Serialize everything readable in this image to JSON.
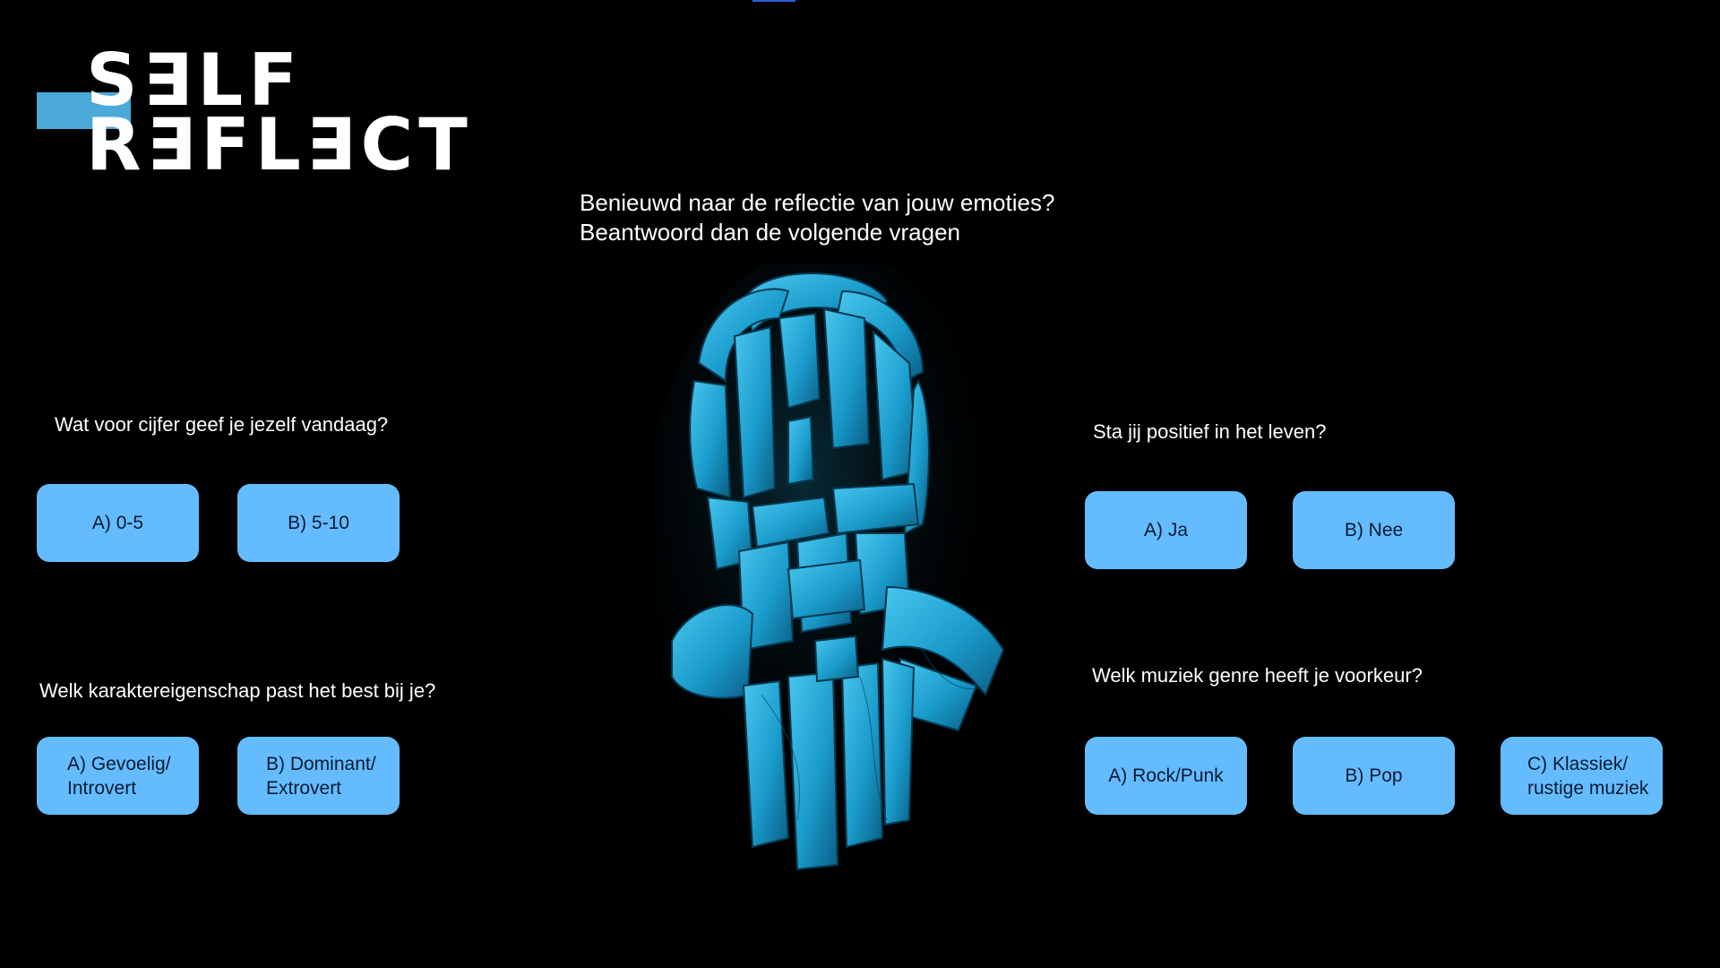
{
  "logo": {
    "line1": "S∃LF",
    "line2": "R∃FL∃CT"
  },
  "intro": {
    "line1": "Benieuwd naar de reflectie van jouw emoties?",
    "line2": "Beantwoord dan de volgende vragen"
  },
  "questions": [
    {
      "text": "Wat voor cijfer geef je jezelf vandaag?",
      "options": [
        "A) 0-5",
        "B) 5-10"
      ]
    },
    {
      "text": "Welk karaktereigenschap past het best bij je?",
      "options": [
        "A) Gevoelig/\nIntrovert",
        "B) Dominant/\nExtrovert"
      ]
    },
    {
      "text": "Sta jij positief in het leven?",
      "options": [
        "A) Ja",
        "B) Nee"
      ]
    },
    {
      "text": "Welk muziek genre heeft je voorkeur?",
      "options": [
        "A) Rock/Punk",
        "B) Pop",
        "C) Klassiek/\nrustige muziek"
      ]
    }
  ],
  "colors": {
    "button": "#64bcff",
    "accent": "#4aa9d6",
    "background": "#000000",
    "art": "#1e9ed0"
  },
  "image": {
    "icon": "ribbon-head-sculpture"
  }
}
